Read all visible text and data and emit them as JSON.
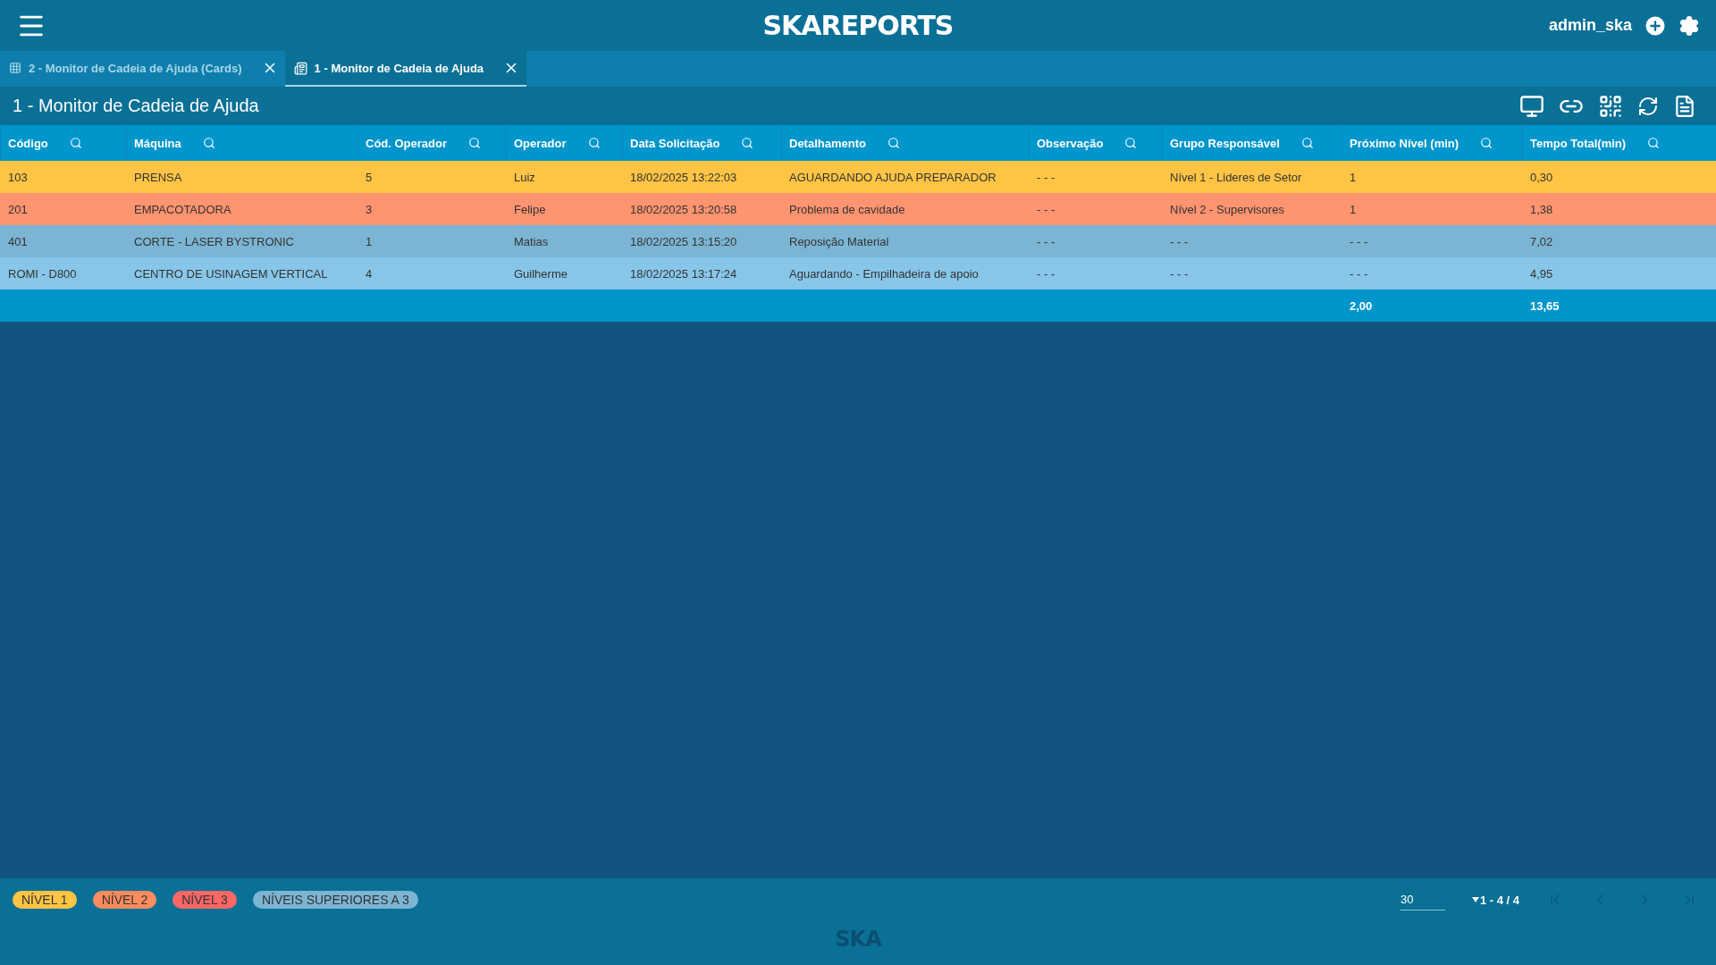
{
  "header": {
    "logo": "SKAREPORTS",
    "user": "admin_ska"
  },
  "tabs": [
    {
      "label": "2 - Monitor de Cadeia de Ajuda (Cards)",
      "kind": "cards",
      "selected": false
    },
    {
      "label": "1 - Monitor de Cadeia de Ajuda",
      "kind": "table",
      "selected": true
    }
  ],
  "page_title": "1 - Monitor de Cadeia de Ajuda",
  "table": {
    "columns": [
      {
        "label": "Código"
      },
      {
        "label": "Máquina"
      },
      {
        "label": "Cód. Operador"
      },
      {
        "label": "Operador"
      },
      {
        "label": "Data Solicitação"
      },
      {
        "label": "Detalhamento"
      },
      {
        "label": "Observação"
      },
      {
        "label": "Grupo Responsável"
      },
      {
        "label": "Próximo Nível (min)",
        "total": "2,00"
      },
      {
        "label": "Tempo Total(min)",
        "total": "13,65"
      }
    ],
    "rows": [
      {
        "color": "#ffc444",
        "cells": [
          "103",
          "PRENSA",
          "5",
          "Luiz",
          "18/02/2025 13:22:03",
          "AGUARDANDO AJUDA PREPARADOR",
          "- - -",
          "Nível 1 - Lideres de Setor",
          "1",
          "0,30"
        ]
      },
      {
        "color": "#ff9470",
        "cells": [
          "201",
          "EMPACOTADORA",
          "3",
          "Felipe",
          "18/02/2025 13:20:58",
          "Problema de cavidade",
          "- - -",
          "Nível 2 - Supervisores",
          "1",
          "1,38"
        ]
      },
      {
        "color": "#7cb5d4",
        "cells": [
          "401",
          "CORTE - LASER BYSTRONIC",
          "1",
          "Matias",
          "18/02/2025 13:15:20",
          "Reposição Material",
          "- - -",
          "- - -",
          "- - -",
          "7,02"
        ]
      },
      {
        "color": "#87c6e8",
        "cells": [
          "ROMI - D800",
          "CENTRO DE USINAGEM VERTICAL",
          "4",
          "Guilherme",
          "18/02/2025 13:17:24",
          "Aguardando - Empilhadeira de apoio",
          "- - -",
          "- - -",
          "- - -",
          "4,95"
        ]
      }
    ]
  },
  "legend": [
    {
      "label": "NÍVEL 1",
      "color": "#ffc444"
    },
    {
      "label": "NÍVEL 2",
      "color": "#ff8c5e"
    },
    {
      "label": "NÍVEL 3",
      "color": "#ff6666"
    },
    {
      "label": "NÍVEIS SUPERIORES A 3",
      "color": "#7cb5d4"
    }
  ],
  "pagination": {
    "page_size": "30",
    "range": "1 - 4 / 4",
    "first_disabled": true,
    "prev_disabled": true,
    "next_disabled": true,
    "last_disabled": true
  },
  "footer_logo": "SKA"
}
